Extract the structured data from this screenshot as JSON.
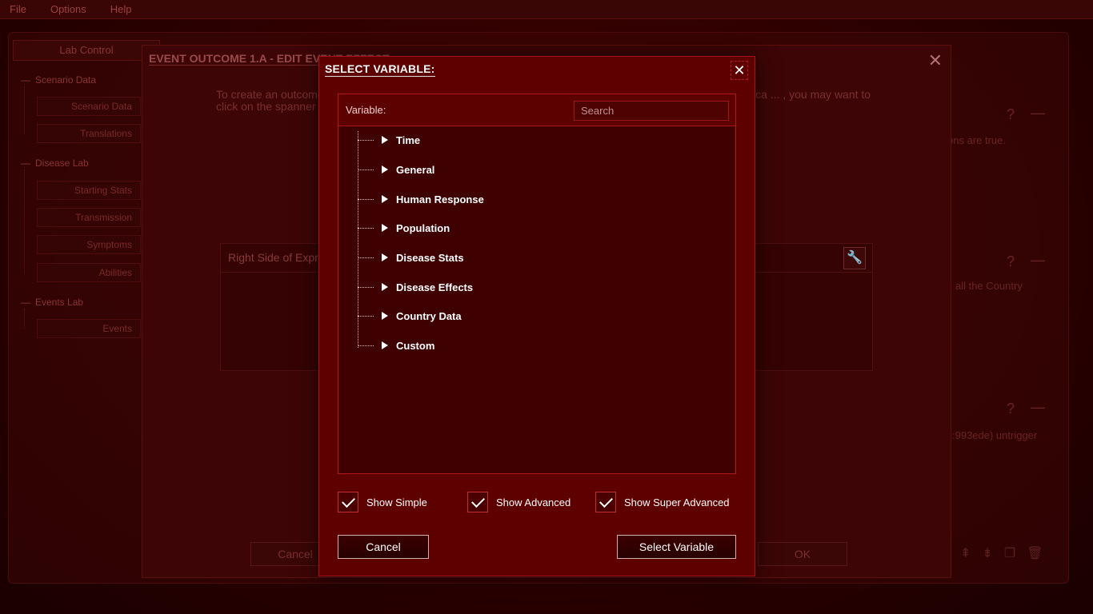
{
  "menu": {
    "file": "File",
    "options": "Options",
    "help": "Help"
  },
  "sidebar": {
    "header": "Lab Control",
    "sections": [
      {
        "label": "Scenario Data",
        "items": [
          "Scenario Data",
          "Translations"
        ]
      },
      {
        "label": "Disease Lab",
        "items": [
          "Starting Stats",
          "Transmission",
          "Symptoms",
          "Abilities"
        ]
      },
      {
        "label": "Events Lab",
        "items": [
          "Events"
        ]
      }
    ]
  },
  "edit_dialog": {
    "title": "EVENT OUTCOME 1.A - EDIT EVENT EFFECT",
    "description": "To create an outcome ... ing new (use '='), or add/subtract etc an ... a formula, use the 'Add Row' button. You ca ... , you may want to click on the spanner icon",
    "right_side_label": "Right Side of Expr",
    "cancel_label": "Cancel",
    "ok_label": "OK"
  },
  "right_panels": {
    "note1": "ons are true.",
    "note2": "all the Country",
    "note3": ":993ede) untrigger"
  },
  "modal": {
    "title": "SELECT VARIABLE:",
    "variable_label": "Variable:",
    "search_placeholder": "Search",
    "tree": [
      "Time",
      "General",
      "Human Response",
      "Population",
      "Disease Stats",
      "Disease Effects",
      "Country Data",
      "Custom"
    ],
    "checkboxes": {
      "simple": "Show Simple",
      "advanced": "Show Advanced",
      "super_advanced": "Show Super Advanced"
    },
    "cancel_label": "Cancel",
    "select_label": "Select Variable"
  }
}
